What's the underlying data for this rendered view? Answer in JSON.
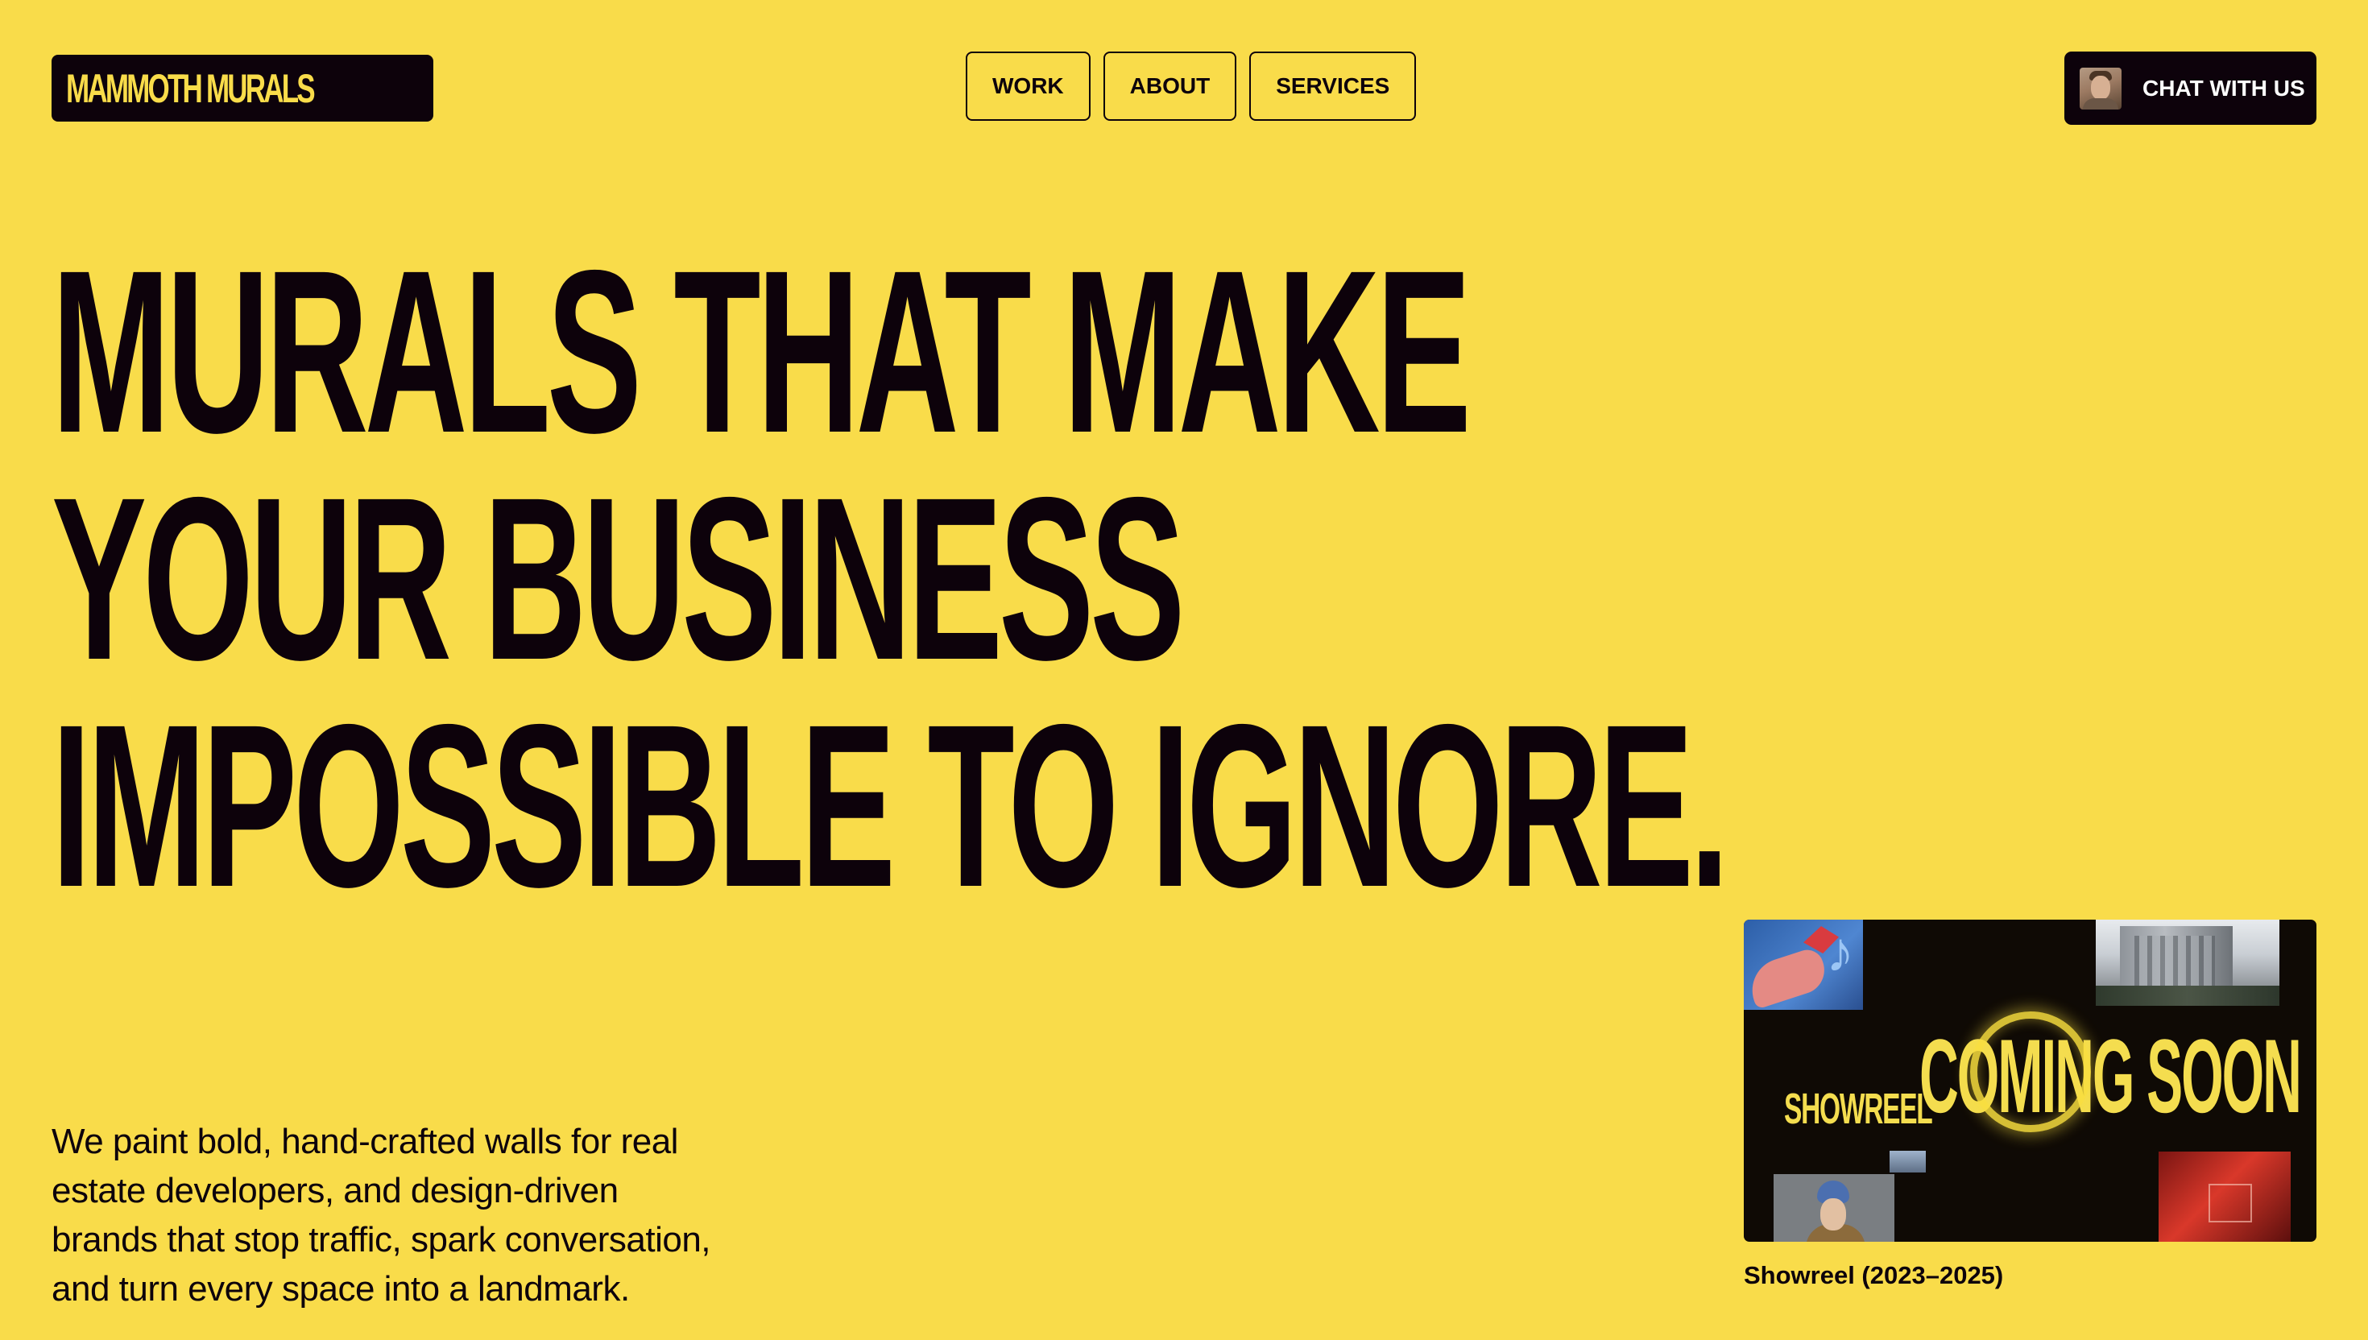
{
  "brand": {
    "logo_text": "MAMMOTH MURALS"
  },
  "nav": {
    "items": [
      {
        "label": "WORK"
      },
      {
        "label": "ABOUT"
      },
      {
        "label": "SERVICES"
      }
    ]
  },
  "cta": {
    "chat_label": "CHAT WITH US",
    "avatar_icon": "person-avatar"
  },
  "hero": {
    "headline_lines": [
      "MURALS THAT MAKE",
      "YOUR BUSINESS",
      "IMPOSSIBLE TO IGNORE."
    ],
    "intro_lines": [
      "We paint bold, hand-crafted walls for real",
      "estate developers, and design-driven",
      "brands that stop traffic, spark conversation,",
      "and turn every space into a landmark."
    ]
  },
  "showreel": {
    "label": "SHOWREEL",
    "overlay_text": "COMING SOON",
    "caption": "Showreel (2023–2025)",
    "play_icon": "play-ring-icon"
  },
  "colors": {
    "background": "#f9dc4a",
    "ink": "#0d020b",
    "showreel_text": "#f4dd4f"
  }
}
